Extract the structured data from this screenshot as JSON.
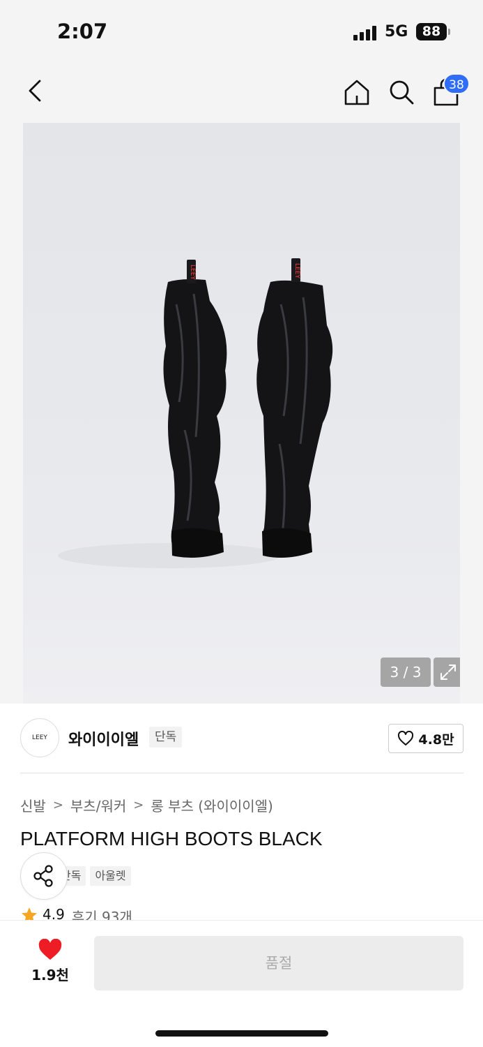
{
  "status_bar": {
    "time": "2:07",
    "network": "5G",
    "battery": "88"
  },
  "nav": {
    "cart_count": "38",
    "icons": [
      "chevron-left-icon",
      "home-icon",
      "search-icon",
      "bag-icon"
    ]
  },
  "gallery": {
    "counter": "3 / 3",
    "image_label": "LEEY"
  },
  "brand": {
    "logo_text": "LEEY",
    "name": "와이이이엘",
    "tag": "단독",
    "like_count": "4.8만"
  },
  "breadcrumb": [
    "신발",
    "부츠/워커",
    "롱 부츠 (와이이이엘)"
  ],
  "product": {
    "title": "PLATFORM HIGH BOOTS BLACK",
    "tags": [
      "단독",
      "아울렛"
    ],
    "rating": "4.9",
    "reviews": "후기 93개"
  },
  "bottom": {
    "wish_count": "1.9천",
    "buy_label": "품절"
  },
  "colors": {
    "accent": "#2f6df6",
    "heart": "#ee1c25",
    "star": "#f5a623"
  }
}
